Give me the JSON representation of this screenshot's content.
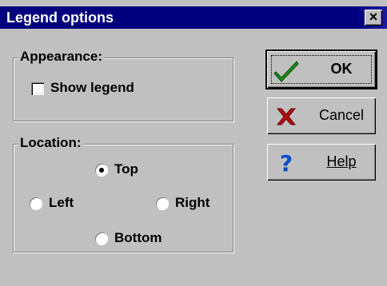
{
  "dialog": {
    "title": "Legend options",
    "close_glyph": "×",
    "appearance": {
      "group_label": "Appearance:",
      "show_legend_label": "Show legend",
      "show_legend_checked": false
    },
    "location": {
      "group_label": "Location:",
      "options": {
        "top": "Top",
        "left": "Left",
        "right": "Right",
        "bottom": "Bottom"
      },
      "selected": "top"
    },
    "buttons": {
      "ok": "OK",
      "cancel": "Cancel",
      "help": "Help"
    },
    "colors": {
      "titlebar": "#00007f",
      "ok_check": "#1a8c1a",
      "cancel_x": "#b01010",
      "help_q": "#0050c8"
    }
  }
}
